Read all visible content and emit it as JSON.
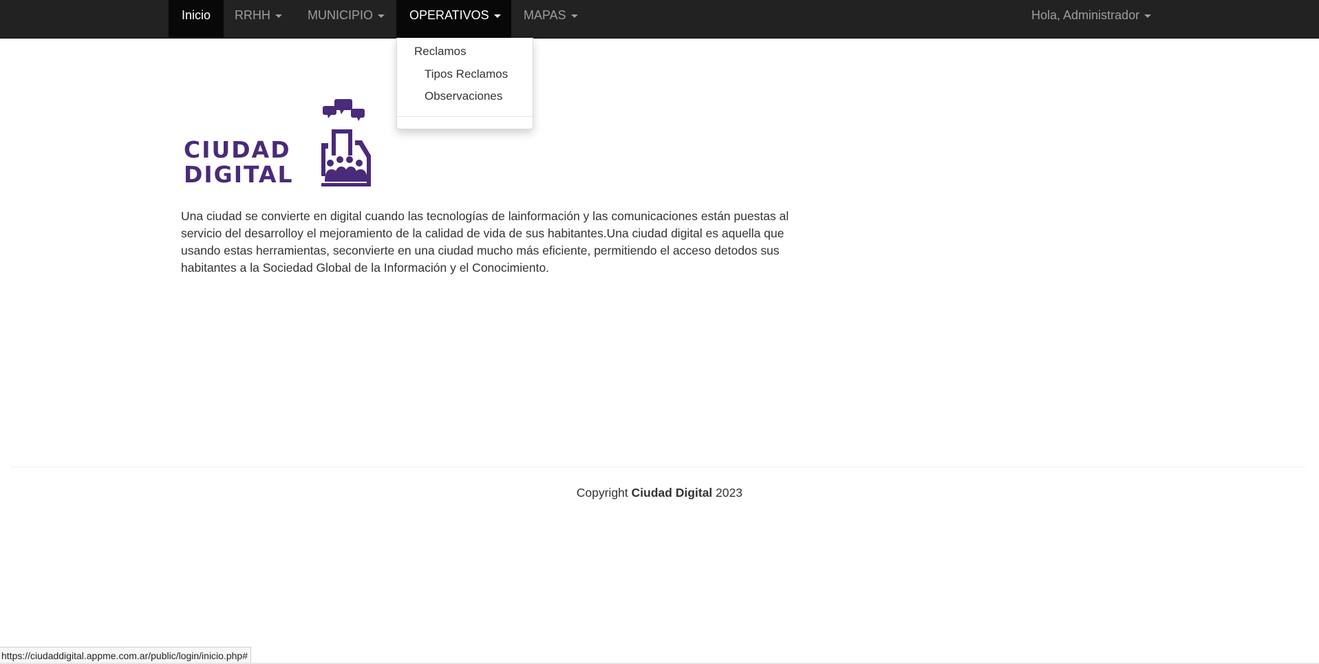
{
  "navbar": {
    "items": [
      {
        "label": "Inicio",
        "active": true,
        "dropdown": false
      },
      {
        "label": "RRHH",
        "dropdown": true
      },
      {
        "label": "MUNICIPIO",
        "dropdown": true
      },
      {
        "label": "OPERATIVOS",
        "dropdown": true,
        "open": true
      },
      {
        "label": "MAPAS",
        "dropdown": true
      }
    ],
    "user_menu": {
      "label": "Hola, Administrador",
      "dropdown": true
    }
  },
  "operativos_menu": {
    "items": [
      "Reclamos",
      "Tipos Reclamos",
      "Observaciones"
    ]
  },
  "logo": {
    "text_line1": "CIUDAD",
    "text_line2": "DIGITAL",
    "icon": "city-people-chat-icon",
    "color": "#4a2a7a"
  },
  "main": {
    "intro_text": "Una ciudad se convierte en digital cuando las tecnologías de lainformación y las comunicaciones están puestas al servicio del desarrolloy el mejoramiento de la calidad de vida de sus habitantes.Una ciudad digital es aquella que usando estas herramientas, seconvierte en una ciudad mucho más eficiente, permitiendo el acceso detodos sus habitantes a la Sociedad Global de la Información y el Conocimiento."
  },
  "footer": {
    "prefix": "Copyright",
    "brand": "Ciudad Digital",
    "year": "2023"
  },
  "statusbar": {
    "url": "https://ciudaddigital.appme.com.ar/public/login/inicio.php#"
  },
  "colors": {
    "navbar_bg": "#222222",
    "navbar_active_bg": "#080808",
    "nav_text": "#9d9d9d",
    "brand_purple": "#4a2a7a"
  }
}
